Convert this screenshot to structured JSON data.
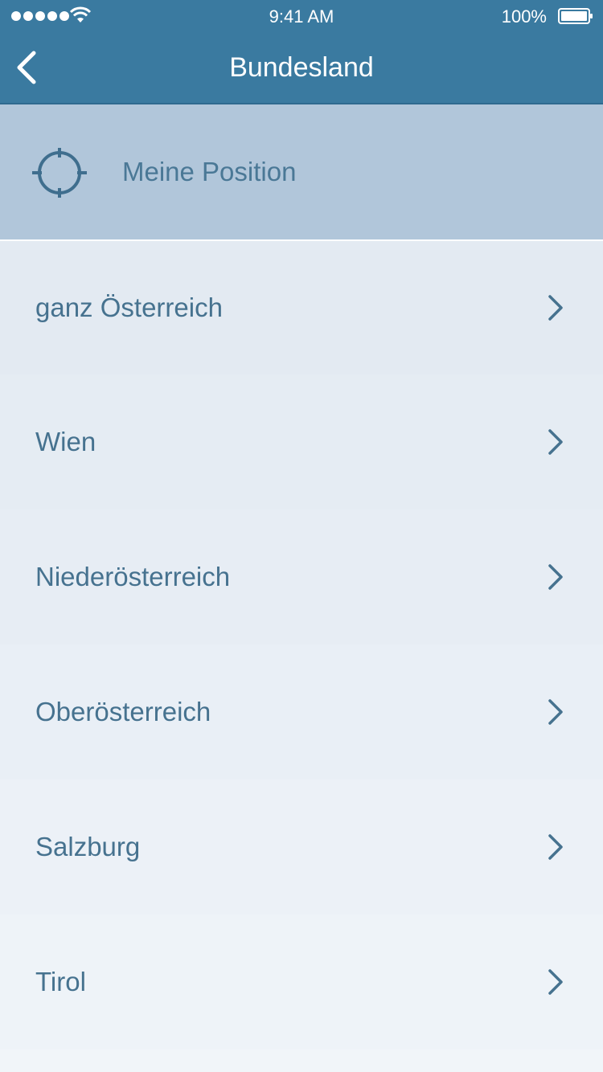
{
  "status_bar": {
    "time": "9:41 AM",
    "battery": "100%",
    "signal_icon": "signal-dots-icon",
    "wifi_icon": "wifi-icon",
    "battery_icon": "battery-full-icon"
  },
  "nav": {
    "title": "Bundesland",
    "back_icon": "chevron-left-icon",
    "color": "#3a7aa0"
  },
  "my_position": {
    "label": "Meine Position",
    "icon": "crosshair-icon",
    "color": "#b1c6da"
  },
  "list": {
    "items": [
      {
        "label": "ganz Österreich"
      },
      {
        "label": "Wien"
      },
      {
        "label": "Niederösterreich"
      },
      {
        "label": "Oberösterreich"
      },
      {
        "label": "Salzburg"
      },
      {
        "label": "Tirol"
      }
    ],
    "chevron_icon": "chevron-right-icon",
    "text_color": "#46728f"
  }
}
